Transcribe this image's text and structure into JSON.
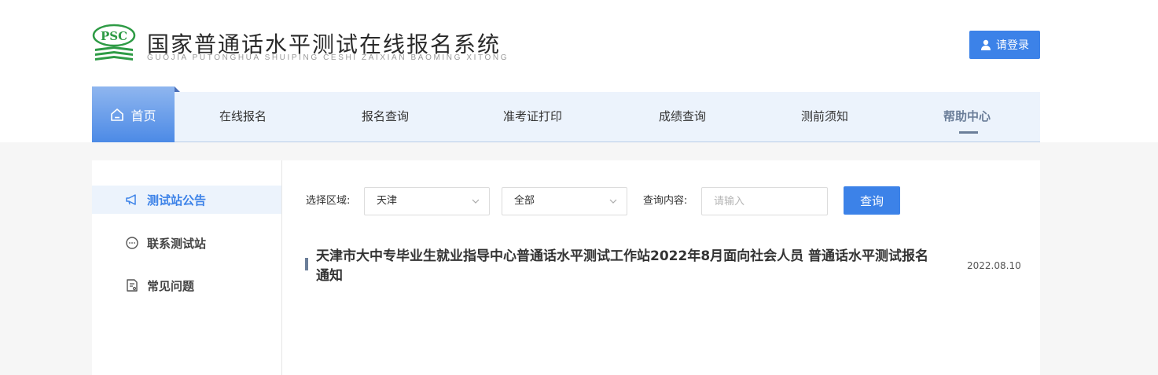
{
  "header": {
    "logo_text": "PSC",
    "title": "国家普通话水平测试在线报名系统",
    "subtitle": "GUOJIA PUTONGHUA SHUIPING CESHI ZAIXIAN BAOMING XITONG",
    "login_label": "请登录"
  },
  "nav": {
    "items": [
      {
        "label": "首页",
        "icon": "home-icon"
      },
      {
        "label": "在线报名"
      },
      {
        "label": "报名查询"
      },
      {
        "label": "准考证打印"
      },
      {
        "label": "成绩查询"
      },
      {
        "label": "测前须知"
      },
      {
        "label": "帮助中心"
      }
    ]
  },
  "sidebar": {
    "items": [
      {
        "label": "测试站公告",
        "icon": "megaphone-icon"
      },
      {
        "label": "联系测试站",
        "icon": "chat-icon"
      },
      {
        "label": "常见问题",
        "icon": "document-icon"
      }
    ]
  },
  "filter": {
    "region_label": "选择区域:",
    "region_value": "天津",
    "category_value": "全部",
    "content_label": "查询内容:",
    "content_placeholder": "请输入",
    "query_label": "查询"
  },
  "articles": [
    {
      "title": "天津市大中专毕业生就业指导中心普通话水平测试工作站2022年8月面向社会人员 普通话水平测试报名通知",
      "date": "2022.08.10"
    }
  ],
  "colors": {
    "primary": "#3c82e8",
    "nav_bg": "#ecf3fc",
    "logo_green": "#2e9b45",
    "muted_blue": "#6b7e99"
  }
}
